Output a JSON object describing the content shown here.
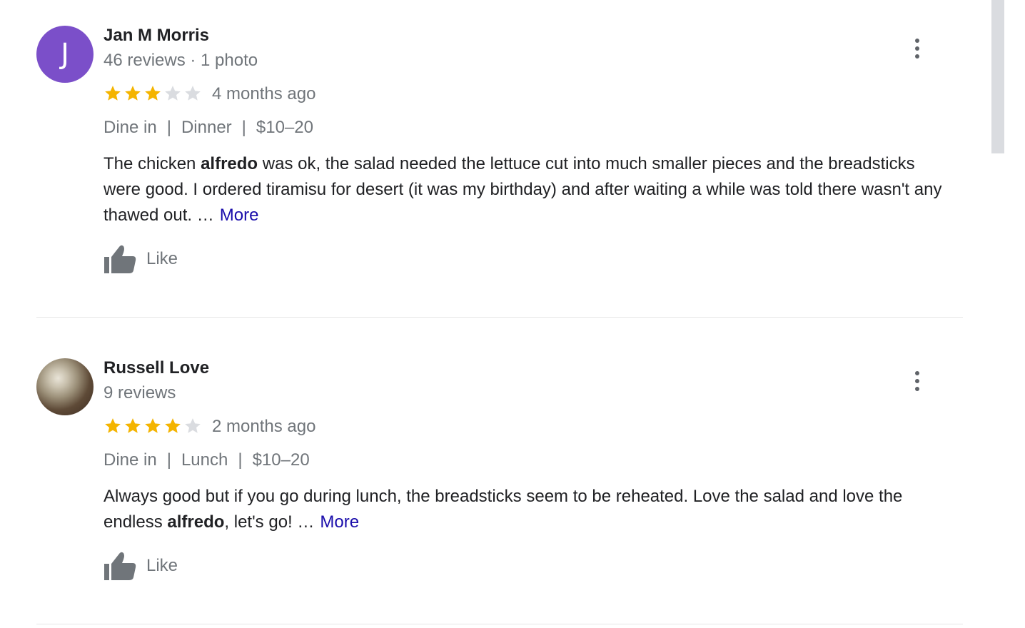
{
  "reviews": [
    {
      "avatar_letter": "J",
      "name": "Jan M Morris",
      "meta": "46 reviews · 1 photo",
      "rating": 3,
      "max_rating": 5,
      "date": "4 months ago",
      "tags": [
        "Dine in",
        "Dinner",
        "$10–20"
      ],
      "separator": "|",
      "text_segments": [
        {
          "text": "The chicken ",
          "bold": false
        },
        {
          "text": "alfredo",
          "bold": true
        },
        {
          "text": " was ok, the salad needed the lettuce cut into much smaller pieces and the breadsticks were good. I ordered tiramisu for desert (it was my birthday) and after waiting a while was told there wasn't any thawed out. …",
          "bold": false
        }
      ],
      "more_label": "More",
      "like_label": "Like"
    },
    {
      "name": "Russell Love",
      "meta": "9 reviews",
      "rating": 4,
      "max_rating": 5,
      "date": "2 months ago",
      "tags": [
        "Dine in",
        "Lunch",
        "$10–20"
      ],
      "separator": "|",
      "text_segments": [
        {
          "text": "Always good but if you go during lunch, the breadsticks seem to be reheated. Love the salad and love the endless ",
          "bold": false
        },
        {
          "text": "alfredo",
          "bold": true
        },
        {
          "text": ", let's go! …",
          "bold": false
        }
      ],
      "more_label": "More",
      "like_label": "Like"
    }
  ],
  "colors": {
    "avatar_bg": "#7b4fc9",
    "star_filled": "#f4b400",
    "star_empty": "#dadce0",
    "link": "#1a0dab",
    "muted_text": "#70757a"
  },
  "icons": {
    "more_options": "vertical-ellipsis-icon",
    "like": "thumbs-up-icon",
    "star": "star-icon"
  }
}
